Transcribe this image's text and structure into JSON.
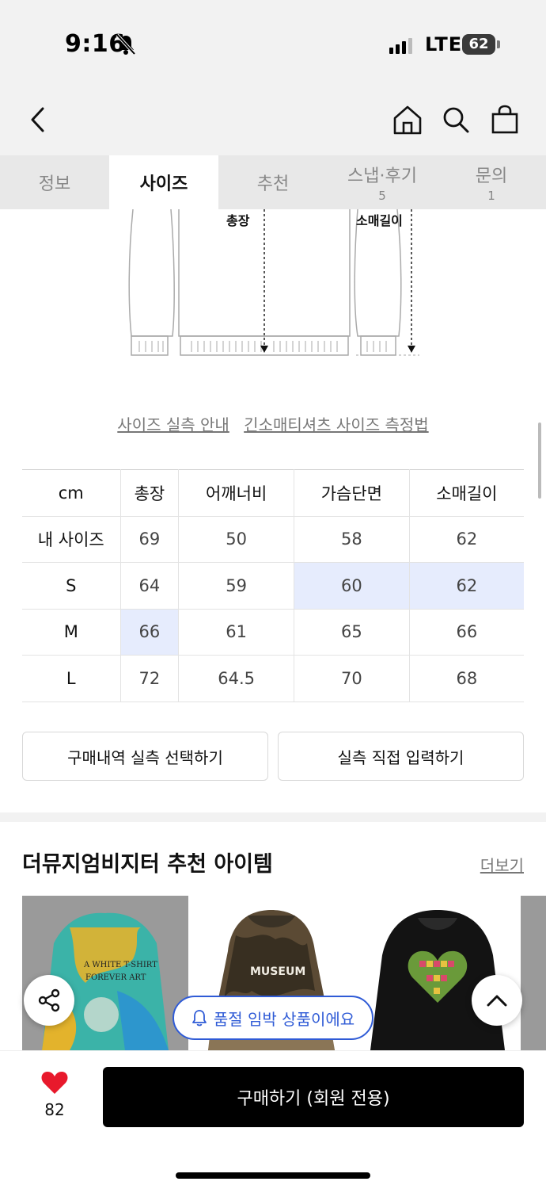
{
  "status_bar": {
    "time": "9:16",
    "network": "LTE",
    "battery": "62"
  },
  "tabs": [
    {
      "label": "정보",
      "count": ""
    },
    {
      "label": "사이즈",
      "count": ""
    },
    {
      "label": "추천",
      "count": ""
    },
    {
      "label": "스냅·후기",
      "count": "5"
    },
    {
      "label": "문의",
      "count": "1"
    }
  ],
  "active_tab": "사이즈",
  "diagram": {
    "length_label": "총장",
    "sleeve_label": "소매길이"
  },
  "links": {
    "guide": "사이즈 실측 안내",
    "method": "긴소매티셔츠 사이즈 측정법"
  },
  "size_table": {
    "headers": [
      "cm",
      "총장",
      "어깨너비",
      "가슴단면",
      "소매길이"
    ],
    "rows": [
      {
        "label": "내 사이즈",
        "values": [
          "69",
          "50",
          "58",
          "62"
        ]
      },
      {
        "label": "S",
        "values": [
          "64",
          "59",
          "60",
          "62"
        ]
      },
      {
        "label": "M",
        "values": [
          "66",
          "61",
          "65",
          "66"
        ]
      },
      {
        "label": "L",
        "values": [
          "72",
          "64.5",
          "70",
          "68"
        ]
      }
    ]
  },
  "buttons": {
    "select_history": "구매내역 실측 선택하기",
    "direct_input": "실측 직접 입력하기"
  },
  "recommend": {
    "title": "더뮤지엄비지터 추천 아이템",
    "more": "더보기"
  },
  "toast": "품절 임박 상품이에요",
  "bottom": {
    "like_count": "82",
    "buy_label": "구매하기 (회원 전용)"
  },
  "colors": {
    "accent": "#2f5bd6",
    "highlight": "#e6ecfd",
    "heart": "#e8192c"
  },
  "products": [
    {
      "print_lines": [
        "A WHITE T-SHIRT",
        "FOREVER ART"
      ]
    },
    {
      "print_lines": [
        "MUSEUM"
      ]
    },
    {
      "print_lines": []
    }
  ]
}
